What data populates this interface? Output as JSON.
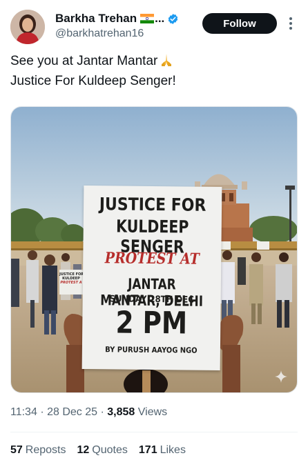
{
  "author": {
    "display_name": "Barkha Trehan",
    "ellipsis": "...",
    "handle": "@barkhatrehan16",
    "flag_icon": "india-flag-icon",
    "verified_icon": "verified-badge-icon",
    "verified_color": "#1d9bf0"
  },
  "follow_button": {
    "label": "Follow"
  },
  "more_icon": "more-vertical-icon",
  "tweet": {
    "line1": "See you at Jantar Mantar",
    "emoji_icon": "folded-hands-emoji",
    "line2": "Justice For Kuldeep Senger!"
  },
  "media": {
    "sign": {
      "line1": "JUSTICE FOR",
      "line2": "KULDEEP SENGER",
      "line3": "PROTEST AT",
      "line4": "JANTAR MANTAR, DELHI",
      "line5": "SUNDAY 28TH DEC",
      "line6": "2 PM",
      "line7": "BY PURUSH AAYOG NGO"
    },
    "background_sign": {
      "line1": "JUSTICE FOR",
      "line2": "KULDEEP",
      "line3": "PROTEST A"
    },
    "sparkle_icon": "ai-sparkle-icon"
  },
  "meta": {
    "time": "11:34",
    "separator": "·",
    "date": "28 Dec 25",
    "views_count": "3,858",
    "views_label": "Views"
  },
  "stats": {
    "reposts_count": "57",
    "reposts_label": "Reposts",
    "quotes_count": "12",
    "quotes_label": "Quotes",
    "likes_count": "171",
    "likes_label": "Likes"
  },
  "colors": {
    "text_primary": "#0f1419",
    "text_secondary": "#536471",
    "follow_bg": "#0f1419",
    "sign_red": "#b62d2b"
  }
}
